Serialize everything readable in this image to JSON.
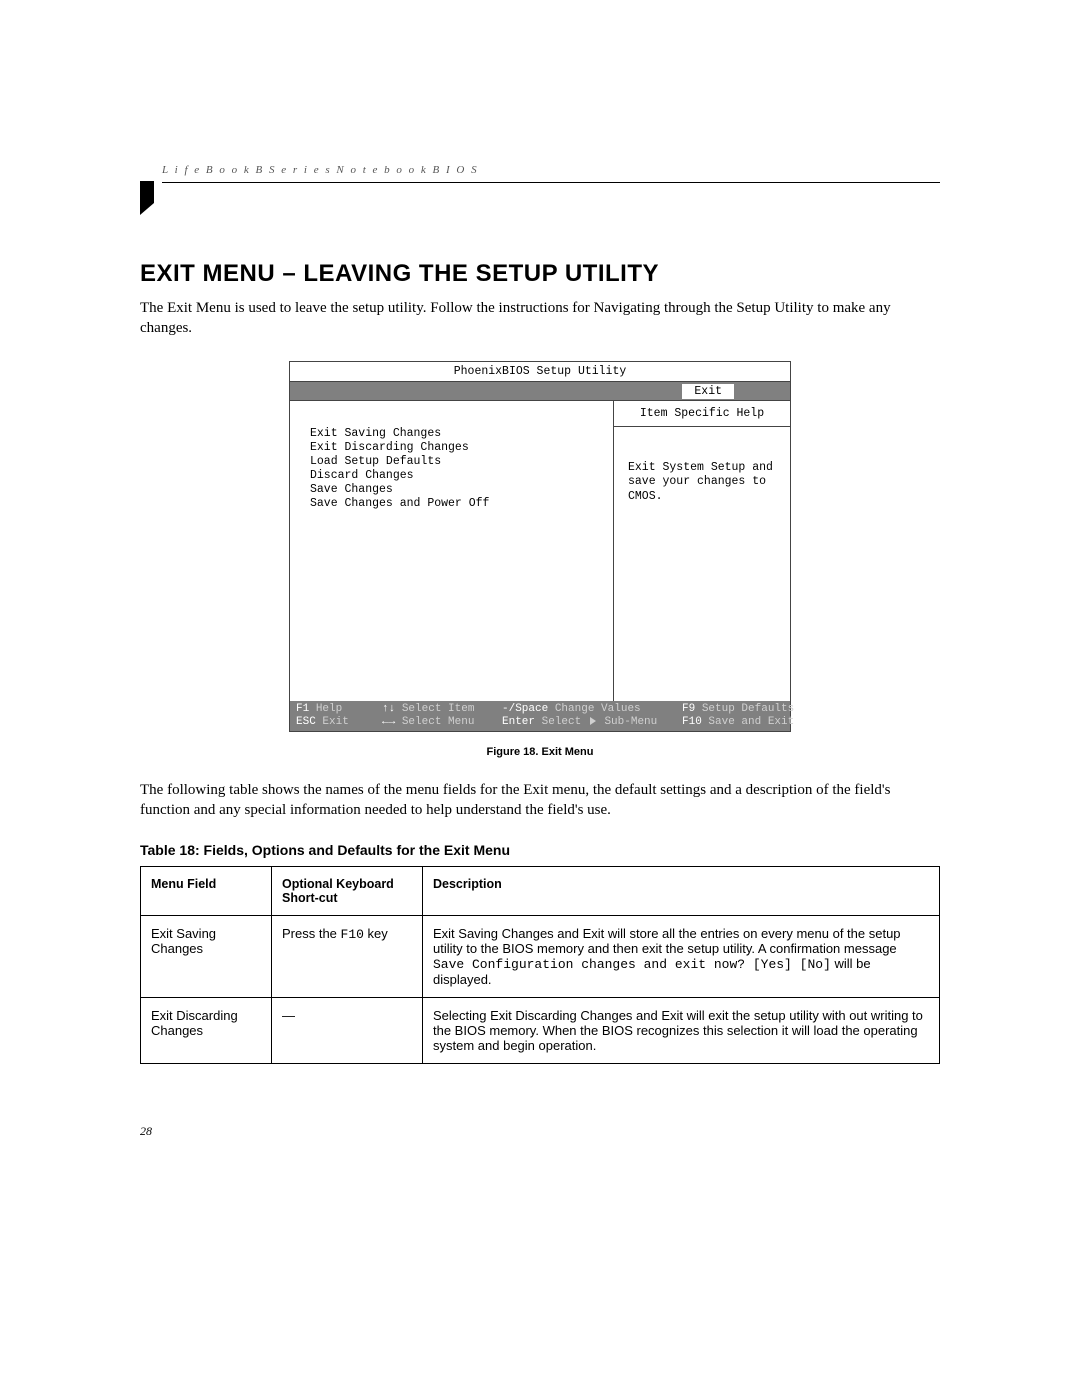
{
  "header": {
    "running_head": "L i f e B o o k   B   S e r i e s   N o t e b o o k   B I O S"
  },
  "section": {
    "title": "EXIT MENU – LEAVING THE SETUP UTILITY",
    "intro": "The Exit Menu is used to leave the setup utility. Follow the instructions for Navigating through the Setup Utility to make any changes."
  },
  "bios": {
    "title": "PhoenixBIOS Setup Utility",
    "active_tab": "Exit",
    "menu_items": {
      "i1": "Exit Saving Changes",
      "i2": "Exit Discarding Changes",
      "i3": "Load Setup Defaults",
      "i4": "Discard Changes",
      "i5": "Save Changes",
      "i6": "Save Changes and Power Off"
    },
    "help_title": "Item Specific Help",
    "help_body": "Exit System Setup and save your changes to CMOS.",
    "footer": {
      "r1c1k": "F1",
      "r1c1l": "Help",
      "r1c2k": "↑↓",
      "r1c2l": "Select Item",
      "r1c3k": "-/Space",
      "r1c3l": "Change Values",
      "r1c4k": "F9",
      "r1c4l": "Setup Defaults",
      "r2c1k": "ESC",
      "r2c1l": "Exit",
      "r2c2k": "←→",
      "r2c2l": "Select Menu",
      "r2c3k": "Enter",
      "r2c3l": "Select",
      "r2c3l2": "Sub-Menu",
      "r2c4k": "F10",
      "r2c4l": "Save and Exit"
    }
  },
  "figure_caption": "Figure 18.  Exit Menu",
  "after_figure": "The following table shows the names of the menu fields for the Exit menu, the default settings and a description of the field's function and any special information needed to help understand the field's use.",
  "table_title": "Table 18: Fields, Options and Defaults for the Exit Menu",
  "table": {
    "head": {
      "c1": "Menu Field",
      "c2": "Optional Keyboard Short-cut",
      "c3": "Description"
    },
    "rows": [
      {
        "field": "Exit Saving Changes",
        "shortcut_pre": "Press the ",
        "shortcut_key": "F10",
        "shortcut_post": " key",
        "desc_a": "Exit Saving Changes and Exit will store all the entries on every menu of the setup utility to the BIOS memory and then exit the setup utility. A confirmation message ",
        "desc_mono": "Save Configuration changes and exit now? [Yes] [No]",
        "desc_b": " will be displayed."
      },
      {
        "field": "Exit Discarding Changes",
        "shortcut_pre": "—",
        "shortcut_key": "",
        "shortcut_post": "",
        "desc_a": "Selecting Exit Discarding Changes and Exit will exit the setup utility with out writing to the BIOS memory. When the BIOS recognizes this selection it will load the operating system and begin operation.",
        "desc_mono": "",
        "desc_b": ""
      }
    ]
  },
  "page_number": "28"
}
